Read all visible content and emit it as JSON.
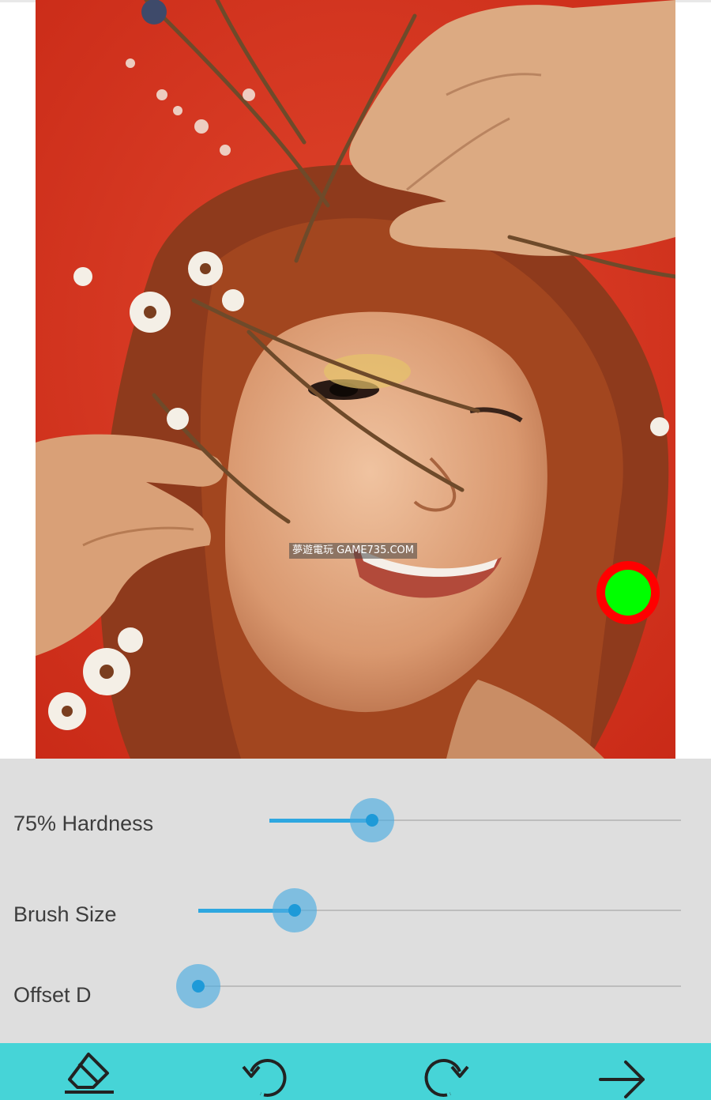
{
  "canvas": {
    "photo_description_icon": "portrait-photo"
  },
  "watermark": {
    "text": "夢遊電玩 GAME735.COM"
  },
  "controls": {
    "hardness": {
      "label": "75% Hardness",
      "value_fraction": 0.25
    },
    "brush_size": {
      "label": "Brush Size",
      "value_fraction": 0.2
    },
    "offset": {
      "label": "Offset D",
      "value_fraction": 0.0
    }
  },
  "toolbar": {
    "items": [
      {
        "icon": "eraser-icon"
      },
      {
        "icon": "undo-icon"
      },
      {
        "icon": "redo-icon"
      },
      {
        "icon": "next-arrow-icon"
      }
    ]
  },
  "colors": {
    "accent": "#2ea7e0",
    "toolbar_bg": "#46d4d7",
    "cursor_outer": "#ff0000",
    "cursor_inner": "#00ff00",
    "controls_bg": "#dedede"
  }
}
